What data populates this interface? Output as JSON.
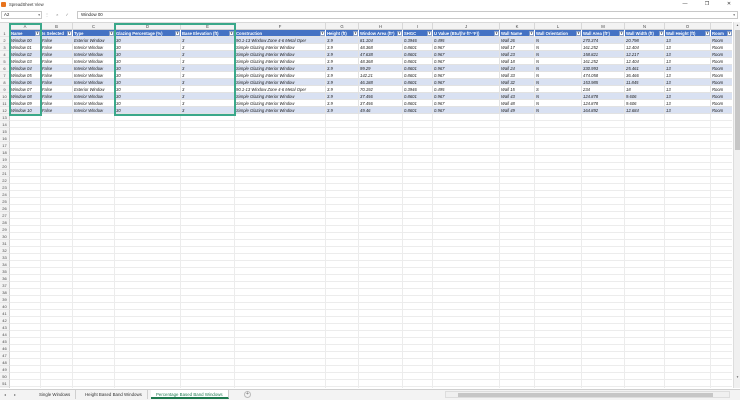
{
  "window": {
    "title": "SpreadSheet View",
    "minimize_glyph": "—",
    "maximize_glyph": "❐",
    "close_glyph": "✕"
  },
  "formula_bar": {
    "cell_ref": "A2",
    "value": "Window 00",
    "icons": "⋮ × ✓"
  },
  "columns": [
    "A",
    "B",
    "C",
    "D",
    "E",
    "F",
    "G",
    "H",
    "I",
    "J",
    "K",
    "L",
    "M",
    "N",
    "O"
  ],
  "headers": [
    "Name",
    "Is Selected",
    "Type",
    "Glazing Percentage (%)",
    "Base Elevation (ft)",
    "Construction",
    "Height (ft)",
    "Window Area (ft²)",
    "SHGC",
    "U Value (Btu/(hr·ft²·°F))",
    "Wall Name",
    "Wall Orientation",
    "Wall Area (ft²)",
    "Wall Width (ft)",
    "Wall Height (ft)",
    "Room"
  ],
  "rows": [
    [
      "Window 00",
      "False",
      "Exterior Window",
      "30",
      "3",
      "90.1-13 Window Zone 4-6 Metal Oper",
      "3.9",
      "81.104",
      "0.3946",
      "0.495",
      "Wall 26",
      "N",
      "270.374",
      "20.798",
      "13",
      "Room"
    ],
    [
      "Window 01",
      "False",
      "Interior Window",
      "30",
      "3",
      "Simple Glazing Interior Window",
      "3.9",
      "48.368",
      "0.8601",
      "0.967",
      "Wall 17",
      "N",
      "161.252",
      "12.404",
      "13",
      "Room"
    ],
    [
      "Window 02",
      "False",
      "Interior Window",
      "30",
      "3",
      "Simple Glazing Interior Window",
      "3.9",
      "47.638",
      "0.8601",
      "0.967",
      "Wall 23",
      "N",
      "158.821",
      "12.217",
      "13",
      "Room"
    ],
    [
      "Window 03",
      "False",
      "Interior Window",
      "30",
      "3",
      "Simple Glazing Interior Window",
      "3.9",
      "48.368",
      "0.8601",
      "0.967",
      "Wall 18",
      "N",
      "161.252",
      "12.404",
      "13",
      "Room"
    ],
    [
      "Window 04",
      "False",
      "Interior Window",
      "30",
      "3",
      "Simple Glazing Interior Window",
      "3.9",
      "99.29",
      "0.8601",
      "0.967",
      "Wall 24",
      "N",
      "330.993",
      "25.461",
      "13",
      "Room"
    ],
    [
      "Window 05",
      "False",
      "Interior Window",
      "30",
      "3",
      "Simple Glazing Interior Window",
      "3.9",
      "142.21",
      "0.8601",
      "0.967",
      "Wall 33",
      "N",
      "474.058",
      "36.466",
      "13",
      "Room"
    ],
    [
      "Window 06",
      "False",
      "Interior Window",
      "30",
      "3",
      "Simple Glazing Interior Window",
      "3.9",
      "46.188",
      "0.8601",
      "0.967",
      "Wall 32",
      "N",
      "153.985",
      "11.845",
      "13",
      "Room"
    ],
    [
      "Window 07",
      "False",
      "Exterior Window",
      "30",
      "3",
      "90.1-13 Window Zone 4-6 Metal Oper",
      "3.9",
      "70.192",
      "0.3946",
      "0.495",
      "Wall 15",
      "S",
      "234",
      "18",
      "13",
      "Room"
    ],
    [
      "Window 08",
      "False",
      "Interior Window",
      "30",
      "3",
      "Simple Glazing Interior Window",
      "3.9",
      "37.456",
      "0.8601",
      "0.967",
      "Wall 43",
      "N",
      "124.878",
      "9.606",
      "13",
      "Room"
    ],
    [
      "Window 09",
      "False",
      "Interior Window",
      "30",
      "3",
      "Simple Glazing Interior Window",
      "3.9",
      "37.456",
      "0.8601",
      "0.967",
      "Wall 48",
      "N",
      "124.878",
      "9.606",
      "13",
      "Room"
    ],
    [
      "Window 10",
      "False",
      "Interior Window",
      "30",
      "3",
      "Simple Glazing Interior Window",
      "3.9",
      "49.46",
      "0.8601",
      "0.967",
      "Wall 49",
      "N",
      "164.892",
      "12.684",
      "13",
      "Room"
    ]
  ],
  "row_numbers": [
    "1",
    "2",
    "3",
    "4",
    "5",
    "6",
    "7",
    "8",
    "9",
    "10",
    "11",
    "12",
    "13",
    "14",
    "15",
    "16",
    "17",
    "18",
    "19",
    "20",
    "21",
    "22",
    "23",
    "24",
    "25",
    "26",
    "27",
    "28",
    "29",
    "30",
    "31",
    "32",
    "33",
    "34",
    "35",
    "36",
    "37",
    "38",
    "39",
    "40",
    "41",
    "42",
    "43",
    "44",
    "45",
    "46",
    "47",
    "48",
    "49",
    "50",
    "51",
    "52"
  ],
  "sheet_tabs": [
    "Single Windows",
    "Height Based Band Windows",
    "Percentage Based Band Windows"
  ],
  "active_tab": 2,
  "nav": {
    "prev": "◂",
    "next": "▸",
    "add": "+"
  },
  "colors": {
    "header_bg": "#4472c4",
    "band_bg": "#d9e1f2",
    "highlight": "#3aa88a",
    "active_tab": "#1e7a4f"
  }
}
